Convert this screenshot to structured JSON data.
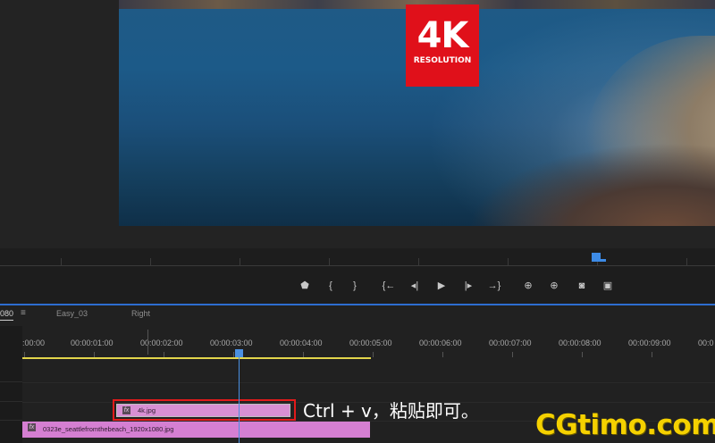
{
  "monitor": {
    "badge": {
      "big_text": "4K",
      "small_text": "RESOLUTION"
    }
  },
  "transport": {
    "buttons": [
      {
        "icon": "marker-icon",
        "glyph": "⬟"
      },
      {
        "icon": "mark-in-icon",
        "glyph": "{"
      },
      {
        "icon": "mark-out-icon",
        "glyph": "}"
      },
      {
        "icon": "go-to-in-icon",
        "glyph": "{←"
      },
      {
        "icon": "step-back-icon",
        "glyph": "◂|"
      },
      {
        "icon": "play-icon",
        "glyph": "▶"
      },
      {
        "icon": "step-forward-icon",
        "glyph": "|▸"
      },
      {
        "icon": "go-to-out-icon",
        "glyph": "→}"
      },
      {
        "icon": "lift-icon",
        "glyph": "⊕"
      },
      {
        "icon": "extract-icon",
        "glyph": "⊕"
      },
      {
        "icon": "export-frame-icon",
        "glyph": "◙"
      },
      {
        "icon": "compare-icon",
        "glyph": "▣"
      }
    ]
  },
  "timeline": {
    "tabs": {
      "active": "080",
      "menu": "≡",
      "easy": "Easy_03",
      "right": "Right"
    },
    "ruler_labels": [
      ":00:00",
      "00:00:01:00",
      "00:00:02:00",
      "00:00:03:00",
      "00:00:04:00",
      "00:00:05:00",
      "00:00:06:00",
      "00:00:07:00",
      "00:00:08:00",
      "00:00:09:00",
      "00:0"
    ],
    "clips": {
      "top": {
        "fx": "fx",
        "name": "4k.jpg"
      },
      "bottom": {
        "fx": "fx",
        "name": "0323e_seattlefromthebeach_1920x1080.jpg"
      }
    }
  },
  "annotation": "Ctrl + v，粘贴即可。",
  "watermark": "CGtimo.com",
  "colors": {
    "accent": "#2d6dd0",
    "clip": "#d88fd3",
    "highlight": "#e11b1b",
    "workarea": "#e2d44b",
    "watermark": "#f5d100"
  }
}
